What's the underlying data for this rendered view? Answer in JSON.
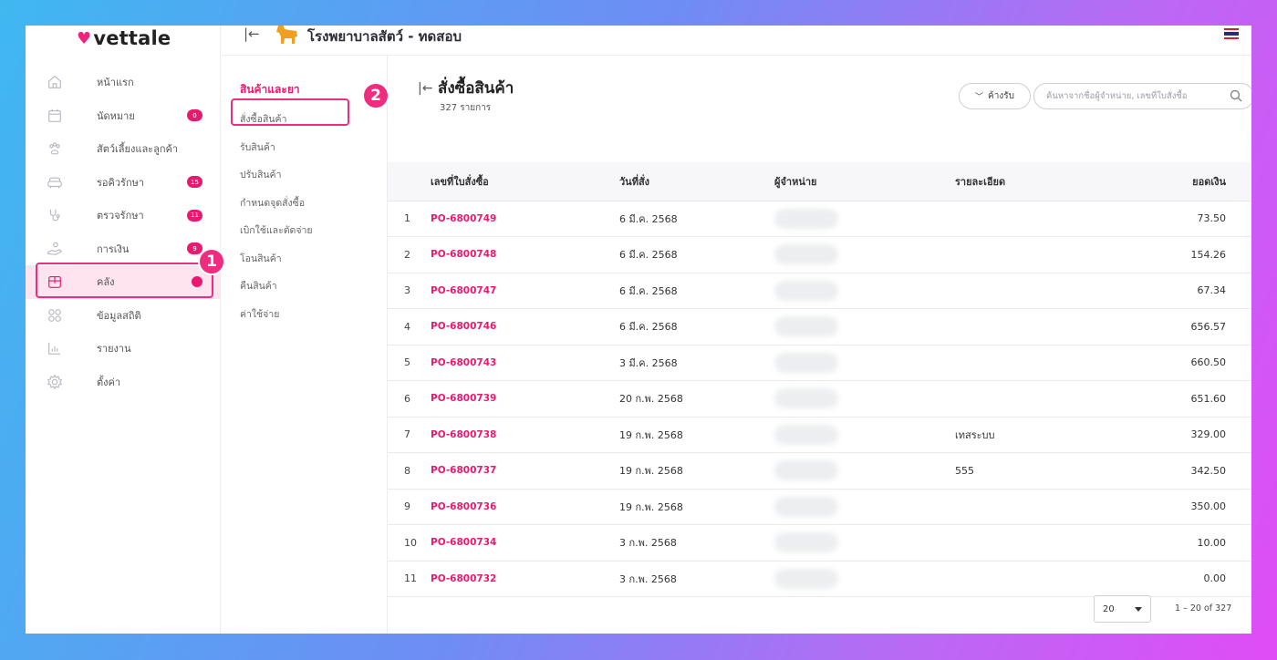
{
  "app": {
    "logo": "vettale",
    "clinic_name": "โรงพยาบาลสัตว์ - ทดสอบ"
  },
  "colors": {
    "accent": "#e8196f",
    "highlight": "#ee2d80"
  },
  "markers": {
    "one": "1",
    "two": "2"
  },
  "nav": {
    "items": [
      {
        "label": "หน้าแรก",
        "icon": "home-icon",
        "badge": ""
      },
      {
        "label": "นัดหมาย",
        "icon": "calendar-icon",
        "badge": "0"
      },
      {
        "label": "สัตว์เลี้ยงและลูกค้า",
        "icon": "paw-icon",
        "badge": ""
      },
      {
        "label": "รอคิวรักษา",
        "icon": "sofa-icon",
        "badge": "15"
      },
      {
        "label": "ตรวจรักษา",
        "icon": "stethoscope-icon",
        "badge": "11"
      },
      {
        "label": "การเงิน",
        "icon": "money-hand-icon",
        "badge": "9"
      },
      {
        "label": "คลัง",
        "icon": "box-icon",
        "badge": ""
      },
      {
        "label": "ข้อมูลสถิติ",
        "icon": "grid-icon",
        "badge": ""
      },
      {
        "label": "รายงาน",
        "icon": "bar-chart-icon",
        "badge": ""
      },
      {
        "label": "ตั้งค่า",
        "icon": "gear-icon",
        "badge": ""
      }
    ]
  },
  "submenu": {
    "heading": "สินค้าและยา",
    "items": [
      "สั่งซื้อสินค้า",
      "รับสินค้า",
      "ปรับสินค้า",
      "กำหนดจุดสั่งซื้อ",
      "เบิกใช้และตัดจ่าย",
      "โอนสินค้า",
      "คืนสินค้า",
      "ค่าใช้จ่าย"
    ]
  },
  "main": {
    "title": "สั่งซื้อสินค้า",
    "count": "327 รายการ",
    "filter_label": "ค้างรับ",
    "search_placeholder": "ค้นหาจากชื่อผู้จำหน่าย, เลขที่ใบสั่งซื้อ"
  },
  "table": {
    "headers": [
      "เลขที่ใบสั่งซื้อ",
      "วันที่สั่ง",
      "ผู้จำหน่าย",
      "รายละเอียด",
      "ยอดเงิน"
    ],
    "rows": [
      {
        "idx": "1",
        "po": "PO-6800749",
        "date": "6 มี.ค. 2568",
        "detail": "",
        "amount": "73.50"
      },
      {
        "idx": "2",
        "po": "PO-6800748",
        "date": "6 มี.ค. 2568",
        "detail": "",
        "amount": "154.26"
      },
      {
        "idx": "3",
        "po": "PO-6800747",
        "date": "6 มี.ค. 2568",
        "detail": "",
        "amount": "67.34"
      },
      {
        "idx": "4",
        "po": "PO-6800746",
        "date": "6 มี.ค. 2568",
        "detail": "",
        "amount": "656.57"
      },
      {
        "idx": "5",
        "po": "PO-6800743",
        "date": "3 มี.ค. 2568",
        "detail": "",
        "amount": "660.50"
      },
      {
        "idx": "6",
        "po": "PO-6800739",
        "date": "20 ก.พ. 2568",
        "detail": "",
        "amount": "651.60"
      },
      {
        "idx": "7",
        "po": "PO-6800738",
        "date": "19 ก.พ. 2568",
        "detail": "เทสระบบ",
        "amount": "329.00"
      },
      {
        "idx": "8",
        "po": "PO-6800737",
        "date": "19 ก.พ. 2568",
        "detail": "555",
        "amount": "342.50"
      },
      {
        "idx": "9",
        "po": "PO-6800736",
        "date": "19 ก.พ. 2568",
        "detail": "",
        "amount": "350.00"
      },
      {
        "idx": "10",
        "po": "PO-6800734",
        "date": "3 ก.พ. 2568",
        "detail": "",
        "amount": "10.00"
      },
      {
        "idx": "11",
        "po": "PO-6800732",
        "date": "3 ก.พ. 2568",
        "detail": "",
        "amount": "0.00"
      }
    ]
  },
  "pagination": {
    "page_size": "20",
    "range": "1 – 20 of 327"
  }
}
